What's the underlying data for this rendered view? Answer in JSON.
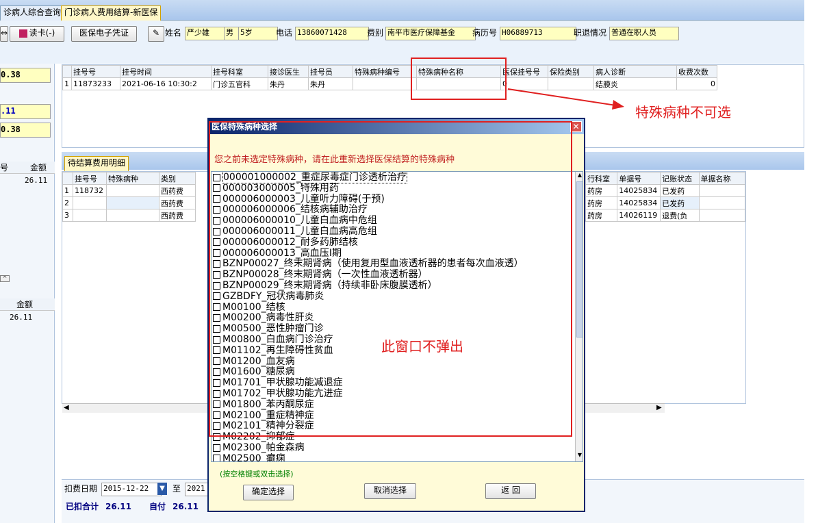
{
  "tabs": [
    {
      "label": "诊病人综合查询"
    },
    {
      "label": "门诊病人费用结算-新医保"
    }
  ],
  "toolbar": {
    "read_card_label": "读卡(-)",
    "e_voucher_label": "医保电子凭证",
    "name_label": "姓名",
    "name_value": "严少雄",
    "gender_value": "男",
    "age_value": "5岁",
    "phone_label": "电话",
    "phone_value": "13860071428",
    "fee_label": "费别",
    "fee_value": "南平市医疗保障基金",
    "record_label": "病历号",
    "record_value": "H06889713",
    "job_label": "职退情况",
    "job_value": "普通在职人员"
  },
  "left_panel": {
    "amount1": "0.38",
    "amount2": ".11",
    "amount3": "0.38",
    "col_hao": "号",
    "col_amount": "金额",
    "row_amount": "26.11",
    "col_amount2": "金额",
    "row_amount2": "26.11"
  },
  "reg_table": {
    "headers": [
      "挂号号",
      "挂号时间",
      "挂号科室",
      "接诊医生",
      "挂号员",
      "特殊病种编号",
      "特殊病种名称",
      "医保挂号号",
      "保险类别",
      "病人诊断",
      "收费次数"
    ],
    "rows": [
      {
        "idx": "1",
        "reg_no": "11873233",
        "reg_time": "2021-06-16 10:30:2",
        "dept": "门诊五官科",
        "doctor": "朱丹",
        "clerk": "朱丹",
        "code": "",
        "name": "",
        "ins_no": "0",
        "ins_type": "",
        "diagnosis": "结膜炎",
        "count": "0"
      }
    ]
  },
  "detail_tab": "待结算费用明细",
  "detail_table": {
    "headers": [
      "挂号号",
      "特殊病种",
      "类别",
      "行科室",
      "单据号",
      "记账状态",
      "单据名称"
    ],
    "rows": [
      {
        "idx": "1",
        "reg_no": "118732",
        "special": "",
        "cat": "西药费",
        "dept": "药房",
        "doc": "14025834",
        "status": "已发药"
      },
      {
        "idx": "2",
        "reg_no": "",
        "special": "",
        "cat": "西药费",
        "dept": "药房",
        "doc": "14025834",
        "status": "已发药"
      },
      {
        "idx": "3",
        "reg_no": "",
        "special": "",
        "cat": "西药费",
        "dept": "药房",
        "doc": "14026119",
        "status": "退费(负"
      }
    ]
  },
  "bottom": {
    "date_label": "扣费日期",
    "date_value": "2015-12-22",
    "to_label": "至",
    "to_value": "2021",
    "deducted_label": "已扣合计",
    "deducted_value": "26.11",
    "self_label": "自付",
    "self_value": "26.11"
  },
  "dialog": {
    "title": "医保特殊病种选择",
    "message": "您之前未选定特殊病种，请在此重新选择医保结算的特殊病种",
    "hint": "(按空格键或双击选择)",
    "confirm": "确定选择",
    "cancel": "取消选择",
    "back": "返 回",
    "items": [
      "000001000002_重症尿毒症门诊透析治疗",
      "000003000005_特殊用药",
      "000006000003_儿童听力障碍(于预)",
      "000006000006_结核病辅助治疗",
      "000006000010_儿童白血病中危组",
      "000006000011_儿童白血病高危组",
      "000006000012_耐多药肺结核",
      "000006000013_高血压I期",
      "BZNP00027_终末期肾病（使用复用型血液透析器的患者每次血液透）",
      "BZNP00028_终末期肾病（一次性血液透析器）",
      "BZNP00029_终末期肾病（持续非卧床腹膜透析）",
      "GZBDFY_冠状病毒肺炎",
      "M00100_结核",
      "M00200_病毒性肝炎",
      "M00500_恶性肿瘤门诊",
      "M00800_白血病门诊治疗",
      "M01102_再生障碍性贫血",
      "M01200_血友病",
      "M01600_糖尿病",
      "M01701_甲状腺功能减退症",
      "M01702_甲状腺功能亢进症",
      "M01800_苯丙酮尿症",
      "M02100_重症精神症",
      "M02101_精神分裂症",
      "M02202_抑郁症",
      "M02300_帕金森病",
      "M02500_癫痫"
    ]
  },
  "annotations": {
    "not_selectable": "特殊病种不可选",
    "no_popup": "此窗口不弹出"
  }
}
